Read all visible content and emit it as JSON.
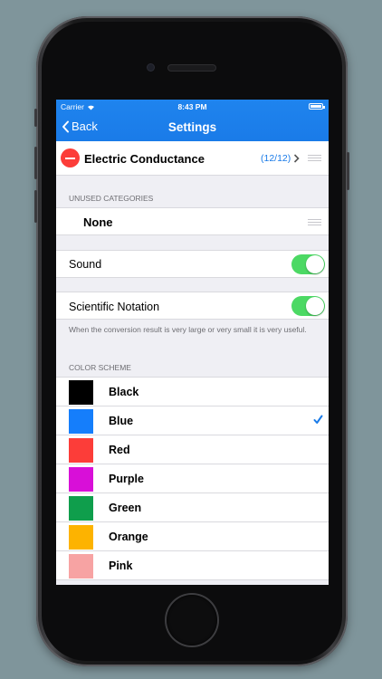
{
  "status_bar": {
    "carrier": "Carrier",
    "time": "8:43 PM"
  },
  "nav": {
    "back_label": "Back",
    "title": "Settings"
  },
  "active_category": {
    "name": "Electric Conductance",
    "count": "(12/12)"
  },
  "unused_categories": {
    "header": "UNUSED CATEGORIES",
    "item": "None"
  },
  "sound": {
    "label": "Sound",
    "enabled": true
  },
  "scientific_notation": {
    "label": "Scientific Notation",
    "enabled": true,
    "footer": "When the conversion result is very large or very small it is very useful."
  },
  "color_scheme": {
    "header": "COLOR SCHEME",
    "selected": "Blue",
    "options": [
      {
        "name": "Black",
        "color": "#000000"
      },
      {
        "name": "Blue",
        "color": "#157efb"
      },
      {
        "name": "Red",
        "color": "#fc3d39"
      },
      {
        "name": "Purple",
        "color": "#d80fd8"
      },
      {
        "name": "Green",
        "color": "#0f9e4c"
      },
      {
        "name": "Orange",
        "color": "#fdb300"
      },
      {
        "name": "Pink",
        "color": "#f7a3a3"
      }
    ]
  },
  "colors": {
    "accent": "#1a7be8",
    "toggle_on": "#4cd964",
    "delete": "#fc3d39"
  }
}
